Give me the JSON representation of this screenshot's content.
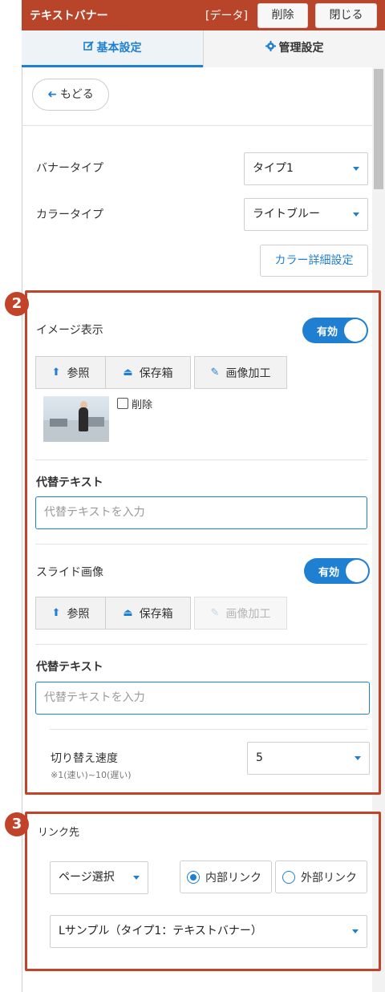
{
  "header": {
    "title": "テキストバナー",
    "data_label": "[データ]",
    "delete_label": "削除",
    "close_label": "閉じる",
    "bg_color": "#b8452a"
  },
  "tabs": [
    {
      "label": "基本設定",
      "icon": "edit-icon",
      "active": true
    },
    {
      "label": "管理設定",
      "icon": "gear-icon",
      "active": false
    }
  ],
  "back_label": "もどる",
  "banner_type": {
    "label": "バナータイプ",
    "value": "タイプ1"
  },
  "color_type": {
    "label": "カラータイプ",
    "value": "ライトブルー"
  },
  "color_detail_label": "カラー詳細設定",
  "section2": {
    "badge": "2",
    "image_display": {
      "label": "イメージ表示",
      "toggle": "有効"
    },
    "buttons": {
      "browse": "参照",
      "storage": "保存箱",
      "edit": "画像加工"
    },
    "delete_checkbox": "削除",
    "alt_text": {
      "label": "代替テキスト",
      "placeholder": "代替テキストを入力"
    },
    "slide_image": {
      "label": "スライド画像",
      "toggle": "有効"
    },
    "slide_buttons": {
      "browse": "参照",
      "storage": "保存箱",
      "edit": "画像加工"
    },
    "slide_alt_text": {
      "label": "代替テキスト",
      "placeholder": "代替テキストを入力"
    },
    "switch_speed": {
      "label": "切り替え速度",
      "note": "※1(速い)~10(遅い)",
      "value": "5"
    }
  },
  "section3": {
    "badge": "3",
    "link_label": "リンク先",
    "page_select": "ページ選択",
    "internal_link": "内部リンク",
    "external_link": "外部リンク",
    "link_target": "Lサンプル（タイプ1：テキストバナー）"
  },
  "colors": {
    "accent": "#1f7fd1",
    "highlight": "#c0432a"
  }
}
